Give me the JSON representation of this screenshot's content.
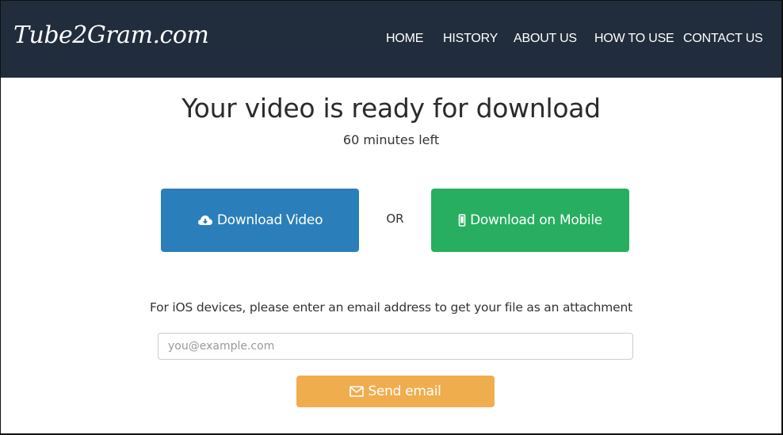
{
  "header": {
    "brand": "Tube2Gram.com",
    "nav": [
      {
        "label": "HOME"
      },
      {
        "label": "HISTORY"
      },
      {
        "label": "ABOUT US"
      },
      {
        "label": "HOW TO USE"
      },
      {
        "label": "CONTACT US"
      }
    ]
  },
  "main": {
    "title": "Your video is ready for download",
    "subtitle": "60 minutes left",
    "download_video": {
      "label": "Download Video",
      "icon": "cloud-download-icon",
      "color": "#2a7fba"
    },
    "separator": "OR",
    "download_mobile": {
      "label": "Download on Mobile",
      "icon": "mobile-phone-icon",
      "color": "#27ae60"
    },
    "ios_note": "For iOS devices, please enter an email address to get your file as an attachment",
    "email": {
      "value": "",
      "placeholder": "you@example.com"
    },
    "send_email": {
      "label": "Send email",
      "icon": "envelope-icon",
      "color": "#f0ad4e"
    }
  },
  "colors": {
    "navbar_bg": "#212d3d"
  }
}
